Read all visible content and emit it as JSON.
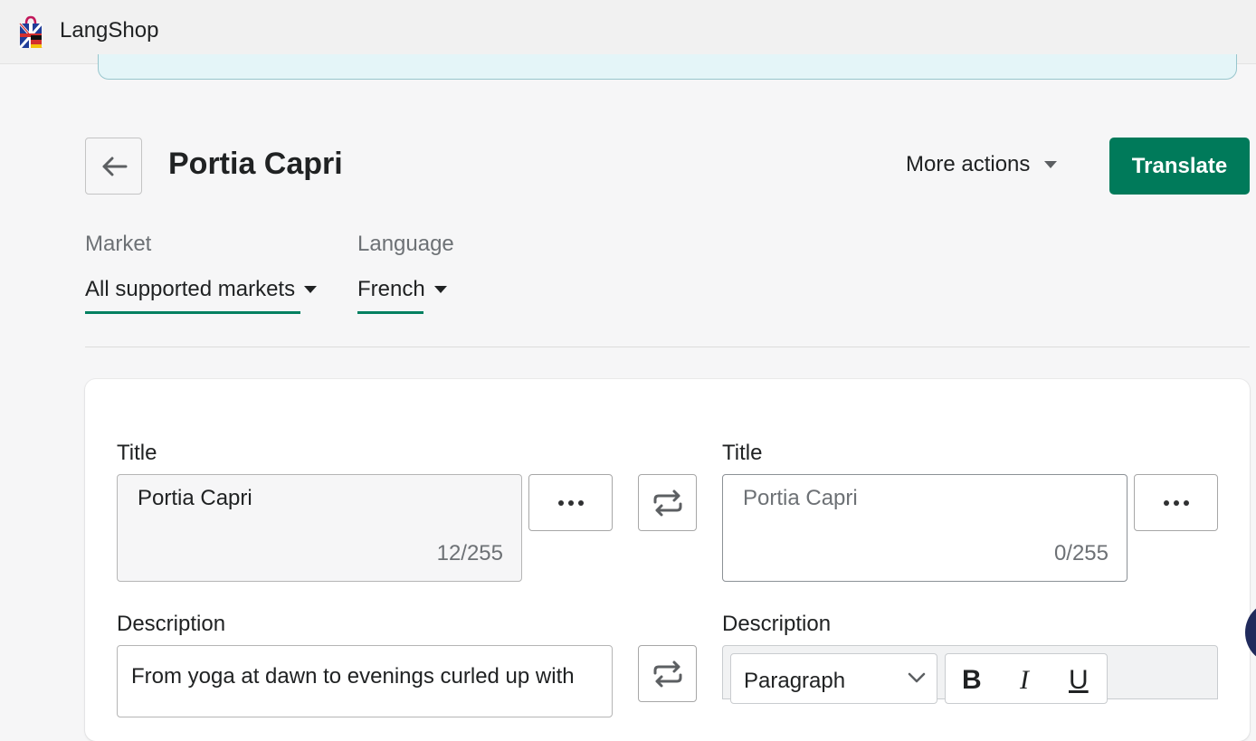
{
  "app": {
    "name": "LangShop",
    "logo_icon": "shopping-bag-flags-icon"
  },
  "header": {
    "title": "Portia Capri",
    "back_icon": "arrow-left-icon",
    "more_actions_label": "More actions",
    "translate_label": "Translate"
  },
  "filters": {
    "market_label": "Market",
    "market_value": "All supported markets",
    "language_label": "Language",
    "language_value": "French"
  },
  "source": {
    "title_label": "Title",
    "title_value": "Portia Capri",
    "title_count": "12/255",
    "description_label": "Description",
    "description_value": "From yoga at dawn to evenings curled up with"
  },
  "target": {
    "title_label": "Title",
    "title_placeholder": "Portia Capri",
    "title_count": "0/255",
    "description_label": "Description",
    "format_value": "Paragraph",
    "bold": "B",
    "italic": "I",
    "underline": "U"
  },
  "colors": {
    "primary": "#007a5a",
    "underline": "#008060",
    "banner": "#e4f5f8"
  }
}
